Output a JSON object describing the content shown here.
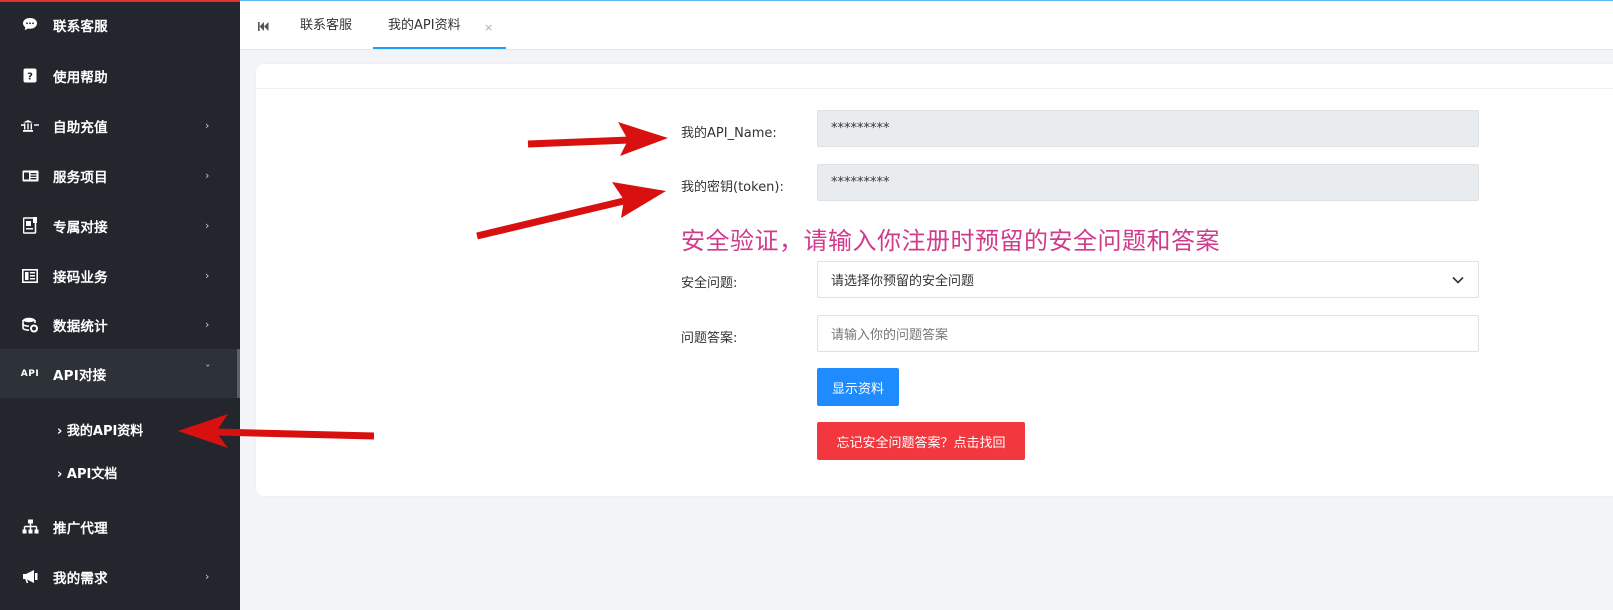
{
  "sidebar": {
    "items": [
      {
        "label": "联系客服",
        "icon": "chat-bubble-icon"
      },
      {
        "label": "使用帮助",
        "icon": "help-question-icon"
      },
      {
        "label": "自助充值",
        "icon": "bank-transfer-icon",
        "arrow": "›"
      },
      {
        "label": "服务项目",
        "icon": "service-card-icon",
        "arrow": "›"
      },
      {
        "label": "专属对接",
        "icon": "exclusive-doc-icon",
        "arrow": "›"
      },
      {
        "label": "接码业务",
        "icon": "sms-code-icon",
        "arrow": "›"
      },
      {
        "label": "数据统计",
        "icon": "database-coins-icon",
        "arrow": "›"
      },
      {
        "label": "API对接",
        "icon": "api-text-icon",
        "arrow": "ˇ",
        "icon_text": "API"
      },
      {
        "label": "推广代理",
        "icon": "org-tree-icon"
      },
      {
        "label": "我的需求",
        "icon": "megaphone-icon",
        "arrow": "›"
      }
    ],
    "sub_items": [
      {
        "label": "› 我的API资料"
      },
      {
        "label": "› API文档"
      }
    ]
  },
  "tabs": [
    {
      "label": "联系客服"
    },
    {
      "label": "我的API资料"
    }
  ],
  "tab_close": "×",
  "form": {
    "api_name_label": "我的API_Name:",
    "api_name_value": "*********",
    "token_label": "我的密钥(token):",
    "token_value": "*********",
    "verify_heading": "安全验证，请输入你注册时预留的安全问题和答案",
    "question_label": "安全问题:",
    "question_select": "请选择你预留的安全问题",
    "answer_label": "问题答案:",
    "answer_placeholder": "请输入你的问题答案",
    "show_button": "显示资料",
    "forgot_button": "忘记安全问题答案？点击找回"
  },
  "colors": {
    "sidebar_bg": "#23272d",
    "accent_blue": "#1e8cff",
    "danger_red": "#f2383e",
    "heading_pink": "#d13b8c",
    "annotation_arrow": "#d81010"
  }
}
